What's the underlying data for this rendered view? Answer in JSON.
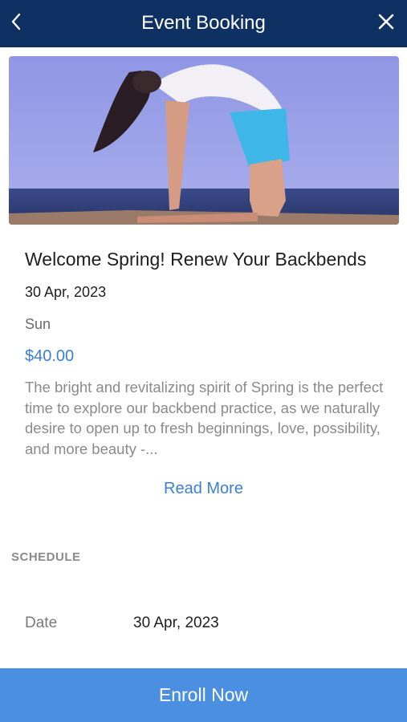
{
  "header": {
    "title": "Event Booking",
    "back_icon": "chevron-left-icon",
    "close_icon": "close-icon",
    "background": "#0f3063"
  },
  "event": {
    "title": "Welcome Spring! Renew Your Backbends",
    "date": "30 Apr, 2023",
    "day": "Sun",
    "price": "$40.00",
    "description": "The bright and revitalizing spirit of Spring is the perfect time to explore our backbend practice, as we naturally desire to open up to fresh beginnings, love, possibility, and more beauty -...",
    "read_more": "Read More",
    "price_color": "#3b7fd6"
  },
  "schedule": {
    "heading": "SCHEDULE",
    "date_label": "Date",
    "date_value": "30 Apr, 2023"
  },
  "footer": {
    "enroll_label": "Enroll Now",
    "background": "#4a8fe0"
  }
}
